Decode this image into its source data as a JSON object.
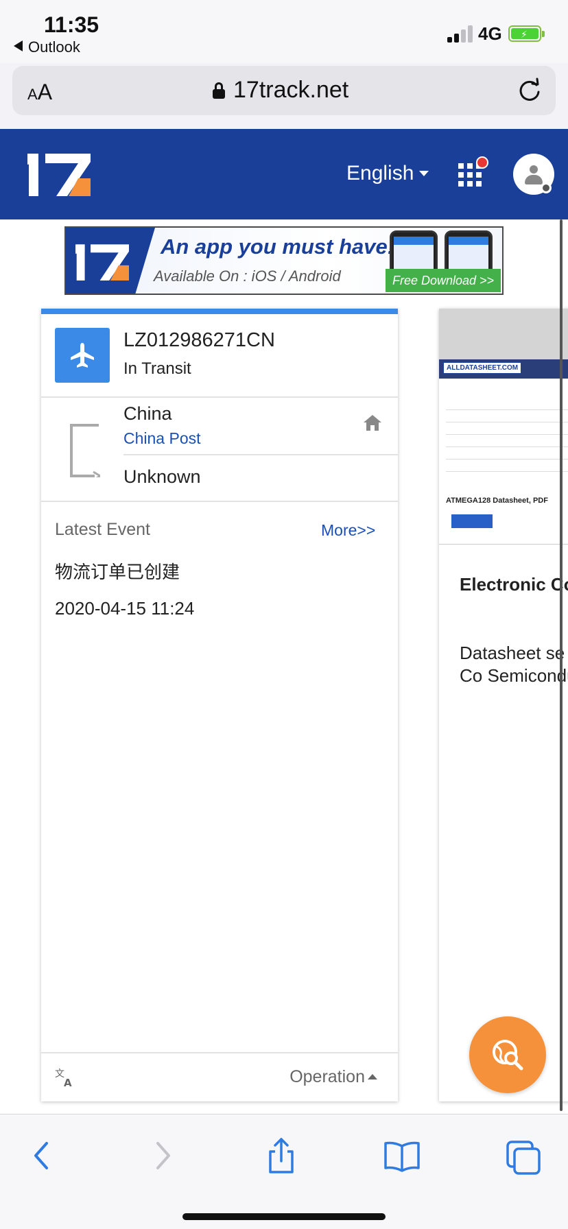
{
  "status_bar": {
    "time": "11:35",
    "back_app": "Outlook",
    "network": "4G"
  },
  "browser": {
    "text_size_label_small": "A",
    "text_size_label_large": "A",
    "domain": "17track.net"
  },
  "site_header": {
    "logo_text": "17",
    "language": "English"
  },
  "banner": {
    "logo_text": "17",
    "headline": "An app you must have!",
    "subline": "Available On : iOS / Android",
    "download_label": "Free Download >>"
  },
  "tracking_card": {
    "tracking_number": "LZ012986271CN",
    "status": "In Transit",
    "origin_country": "China",
    "carrier": "China Post",
    "destination": "Unknown",
    "latest_event_label": "Latest Event",
    "more_label": "More>>",
    "event_text": "物流订单已创建",
    "event_time": "2020-04-15 11:24",
    "operation_label": "Operation"
  },
  "result_card": {
    "thumb_site": "ALLDATASHEET.COM",
    "thumb_title": "ATMEGA128 Datasheet, PDF",
    "title": "Electronic Co Search",
    "description": "Datasheet se Electronic Co Semiconduct"
  },
  "colors": {
    "brand_blue": "#1a3f99",
    "accent_blue": "#3b8ae8",
    "fab_orange": "#f4913a",
    "ios_blue": "#2f7be0"
  }
}
